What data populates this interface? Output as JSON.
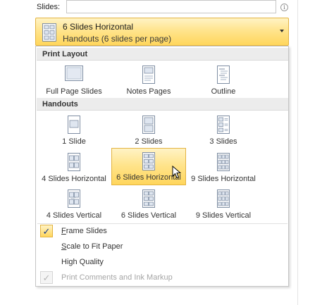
{
  "slides_field": {
    "label": "Slides:",
    "value": "",
    "info_icon": "info-icon"
  },
  "dropdown": {
    "title": "6 Slides Horizontal",
    "subtitle": "Handouts (6 slides per page)",
    "accent": "#ffd65c"
  },
  "print_layout": {
    "header": "Print Layout",
    "options": [
      {
        "label": "Full Page Slides",
        "icon": "full-page-slide-icon"
      },
      {
        "label": "Notes Pages",
        "icon": "notes-pages-icon"
      },
      {
        "label": "Outline",
        "icon": "outline-icon"
      }
    ]
  },
  "handouts": {
    "header": "Handouts",
    "options": [
      {
        "label": "1 Slide",
        "icon": "one-slide-icon"
      },
      {
        "label": "2 Slides",
        "icon": "two-slides-icon"
      },
      {
        "label": "3 Slides",
        "icon": "three-slides-icon"
      },
      {
        "label": "4 Slides Horizontal",
        "icon": "four-slides-horizontal-icon"
      },
      {
        "label": "6 Slides Horizontal",
        "icon": "six-slides-horizontal-icon",
        "selected": true
      },
      {
        "label": "9 Slides Horizontal",
        "icon": "nine-slides-horizontal-icon"
      },
      {
        "label": "4 Slides Vertical",
        "icon": "four-slides-vertical-icon"
      },
      {
        "label": "6 Slides Vertical",
        "icon": "six-slides-vertical-icon"
      },
      {
        "label": "9 Slides Vertical",
        "icon": "nine-slides-vertical-icon"
      }
    ]
  },
  "checks": [
    {
      "label_first": "F",
      "label_rest": "rame Slides",
      "checked": true,
      "enabled": true
    },
    {
      "label_first": "S",
      "label_rest": "cale to Fit Paper",
      "checked": false,
      "enabled": true
    },
    {
      "label_first": "",
      "label_rest": "High Quality",
      "checked": false,
      "enabled": true
    },
    {
      "label_first": "",
      "label_rest": "Print Comments and Ink Markup",
      "checked": true,
      "enabled": false
    }
  ],
  "check_glyph": "✓"
}
